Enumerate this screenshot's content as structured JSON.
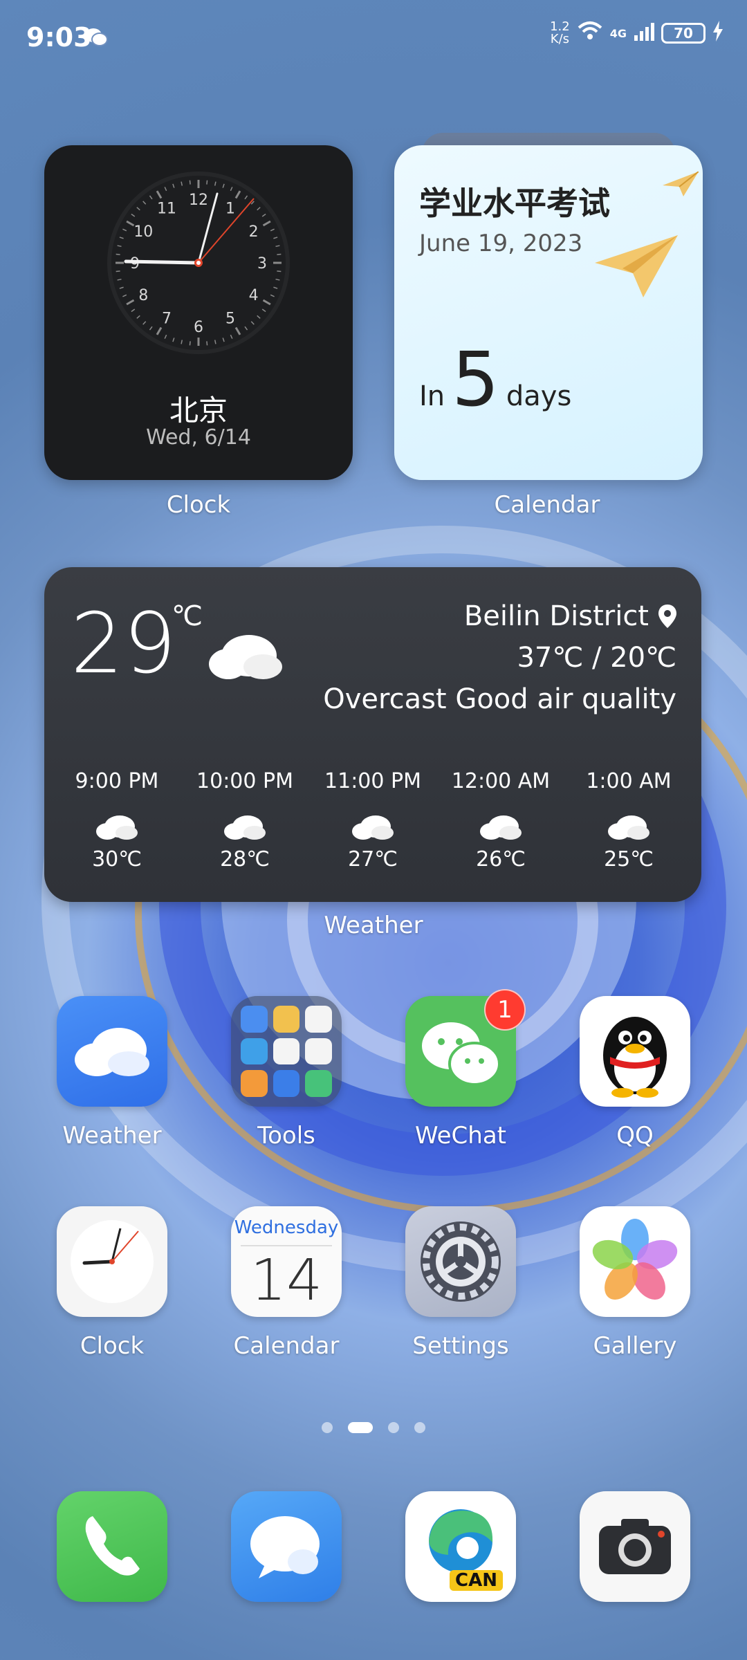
{
  "status_bar": {
    "time": "9:03",
    "speed_value": "1.2",
    "speed_unit": "K/s",
    "network": "4G",
    "battery": "70"
  },
  "clock_widget": {
    "city": "北京",
    "date": "Wed, 6/14",
    "label": "Clock",
    "numerals": [
      "12",
      "1",
      "2",
      "3",
      "4",
      "5",
      "6",
      "7",
      "8",
      "9",
      "10",
      "11"
    ]
  },
  "calendar_widget": {
    "title": "学业水平考试",
    "date": "June 19, 2023",
    "in_label": "In",
    "days_count": "5",
    "days_label": "days",
    "label": "Calendar"
  },
  "weather_widget": {
    "temp": "29",
    "unit": "℃",
    "location": "Beilin District",
    "range": "37℃ / 20℃",
    "condition": "Overcast Good air quality",
    "label": "Weather",
    "hourly": [
      {
        "hour": "9:00 PM",
        "temp": "30℃"
      },
      {
        "hour": "10:00 PM",
        "temp": "28℃"
      },
      {
        "hour": "11:00 PM",
        "temp": "27℃"
      },
      {
        "hour": "12:00 AM",
        "temp": "26℃"
      },
      {
        "hour": "1:00 AM",
        "temp": "25℃"
      }
    ]
  },
  "apps": {
    "weather": "Weather",
    "tools": "Tools",
    "wechat": "WeChat",
    "wechat_badge": "1",
    "qq": "QQ",
    "clock": "Clock",
    "calendar": "Calendar",
    "calendar_weekday": "Wednesday",
    "calendar_day": "14",
    "settings": "Settings",
    "gallery": "Gallery"
  },
  "dock": {
    "edge_badge": "CAN"
  },
  "colors": {
    "badge_red": "#ff3b30",
    "wechat_green": "#55c15e",
    "weather_blue": "#3b82f6"
  }
}
